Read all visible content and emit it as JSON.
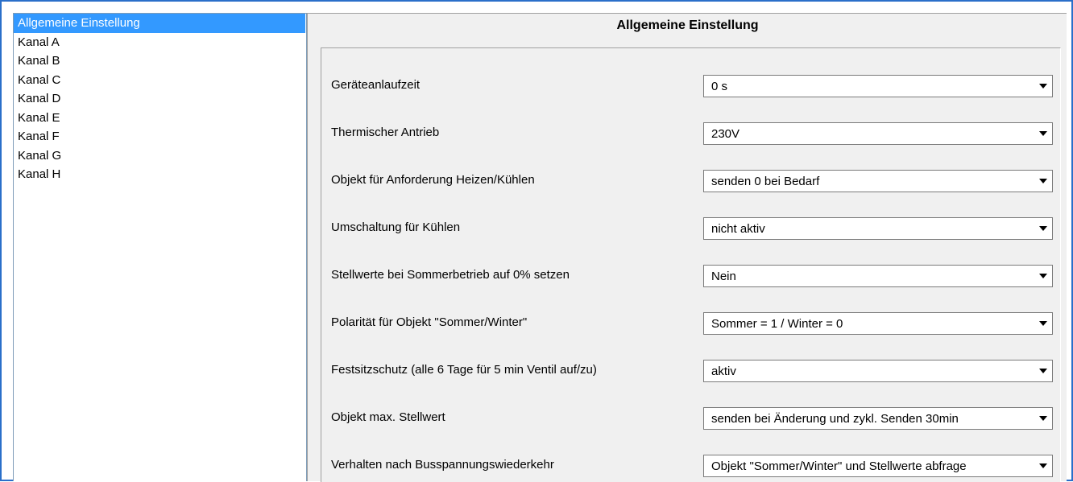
{
  "sidebar": {
    "items": [
      {
        "label": "Allgemeine Einstellung",
        "selected": true
      },
      {
        "label": "Kanal A"
      },
      {
        "label": "Kanal B"
      },
      {
        "label": "Kanal C"
      },
      {
        "label": "Kanal D"
      },
      {
        "label": "Kanal E"
      },
      {
        "label": "Kanal F"
      },
      {
        "label": "Kanal G"
      },
      {
        "label": "Kanal H"
      }
    ]
  },
  "main": {
    "title": "Allgemeine Einstellung",
    "params": [
      {
        "label": "Geräteanlaufzeit",
        "value": "0 s"
      },
      {
        "label": "Thermischer Antrieb",
        "value": "230V"
      },
      {
        "label": "Objekt für Anforderung Heizen/Kühlen",
        "value": "senden 0 bei Bedarf"
      },
      {
        "label": "Umschaltung für Kühlen",
        "value": "nicht aktiv"
      },
      {
        "label": "Stellwerte bei Sommerbetrieb auf 0% setzen",
        "value": "Nein"
      },
      {
        "label": "Polarität für Objekt \"Sommer/Winter\"",
        "value": "Sommer = 1 / Winter = 0"
      },
      {
        "label": "Festsitzschutz (alle 6 Tage für 5 min Ventil auf/zu)",
        "value": "aktiv"
      },
      {
        "label": "Objekt max. Stellwert",
        "value": "senden bei Änderung und zykl. Senden 30min"
      },
      {
        "label": "Verhalten nach Busspannungswiederkehr",
        "value": "Objekt \"Sommer/Winter\" und Stellwerte abfrage"
      }
    ]
  },
  "colors": {
    "selection": "#3399ff",
    "frame": "#2a6fc9",
    "panel_bg": "#f0f0f0"
  },
  "icons": {
    "dropdown": "chevron-down-icon"
  }
}
